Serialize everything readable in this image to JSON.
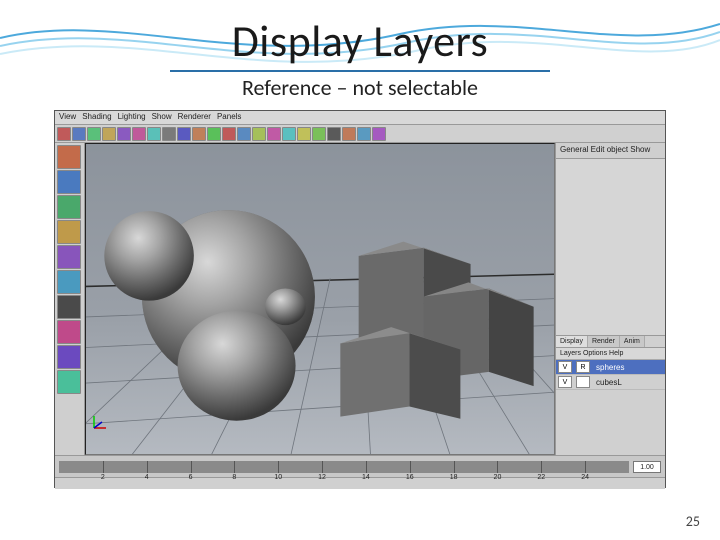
{
  "slide": {
    "title": "Display Layers",
    "subtitle": "Reference – not selectable",
    "page_number": "25"
  },
  "maya": {
    "menubar": [
      "View",
      "Shading",
      "Lighting",
      "Show",
      "Renderer",
      "Panels"
    ],
    "sidepanel": {
      "top_label": "General  Edit object  Show"
    },
    "layers": {
      "tabs": [
        "Display",
        "Render",
        "Anim"
      ],
      "active_tab_index": 0,
      "options_label": "Layers  Options  Help",
      "rows": [
        {
          "vis": "V",
          "ref": "R",
          "name": "spheres",
          "selected": true
        },
        {
          "vis": "V",
          "ref": "",
          "name": "cubesL",
          "selected": false
        }
      ]
    },
    "timeline": {
      "ticks": [
        "2",
        "4",
        "6",
        "8",
        "10",
        "12",
        "14",
        "16",
        "18",
        "20",
        "22",
        "24"
      ],
      "indicator": "1",
      "end_field": "1.00"
    },
    "shelf_colors": [
      "#c05a5a",
      "#5a7ac0",
      "#5ac07a",
      "#c0a55a",
      "#8a5ac0",
      "#c05a9a",
      "#5ac0b8",
      "#7a7a7a",
      "#5a5ac0",
      "#c0805a",
      "#5ac05a",
      "#c05a5a",
      "#5a8ac0",
      "#a5c05a",
      "#c05aa5",
      "#5ac0c0",
      "#c0c05a",
      "#7ac05a",
      "#5a5a5a",
      "#c07a5a",
      "#5a9ac0",
      "#a55ac0"
    ],
    "toolbox_colors": [
      "#c36b4a",
      "#4a7abf",
      "#4aa86b",
      "#bf9a4a",
      "#8855bb",
      "#4a9abf",
      "#4a4a4a",
      "#bf4a8a",
      "#6b4abf",
      "#4abf9a"
    ]
  }
}
